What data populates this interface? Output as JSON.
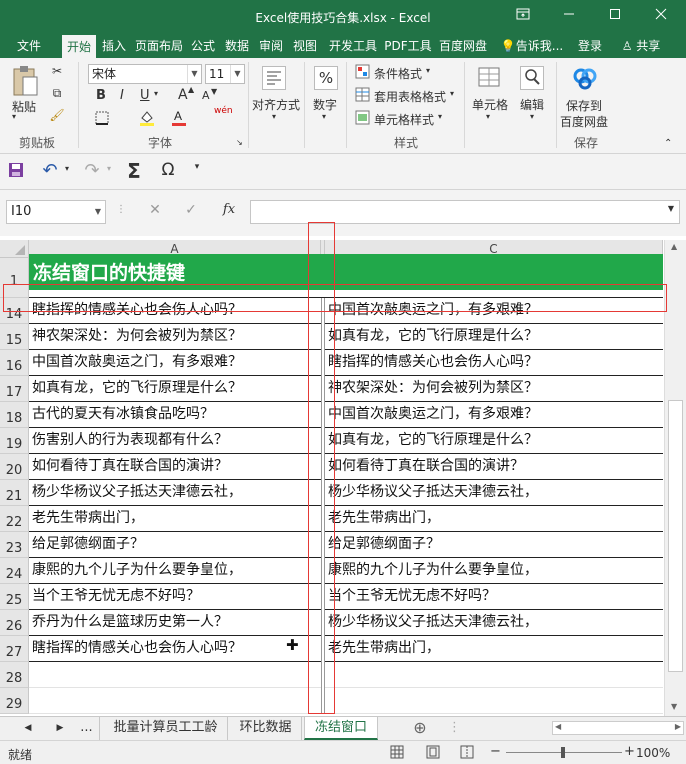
{
  "window": {
    "title": "Excel使用技巧合集.xlsx - Excel",
    "icons": [
      "ribbon-display-icon",
      "minimize-icon",
      "maximize-icon",
      "close-icon"
    ]
  },
  "ribbon_tabs": [
    "文件",
    "开始",
    "插入",
    "页面布局",
    "公式",
    "数据",
    "审阅",
    "视图",
    "开发工具",
    "PDF工具",
    "百度网盘"
  ],
  "tell_me": "告诉我...",
  "signin": "登录",
  "share": "共享",
  "ribbon": {
    "clipboard": {
      "paste": "粘贴",
      "label": "剪贴板"
    },
    "font": {
      "name": "宋体",
      "size": "11",
      "bold": "B",
      "italic": "I",
      "underline": "U",
      "label": "字体",
      "grow": "A",
      "shrink": "A",
      "wen": "wén"
    },
    "alignment": {
      "label": "对齐方式"
    },
    "number": {
      "label": "数字",
      "symbol": "%"
    },
    "styles": {
      "conditional": "条件格式",
      "table": "套用表格格式",
      "cell": "单元格样式",
      "label": "样式"
    },
    "cells": {
      "label": "单元格"
    },
    "editing": {
      "label": "编辑"
    },
    "save": {
      "line1": "保存到",
      "line2": "百度网盘",
      "label": "保存"
    }
  },
  "qat": {
    "sigma": "Σ",
    "omega": "Ω"
  },
  "formula_bar": {
    "namebox": "I10",
    "fx": "fx",
    "value": ""
  },
  "grid": {
    "col_headers": [
      "A",
      "C"
    ],
    "banner": "冻结窗口的快捷键",
    "rows": [
      {
        "num": "1",
        "a": "",
        "c": ""
      },
      {
        "num": "14",
        "a": "瞎指挥的情感关心也会伤人心吗？",
        "c": "中国首次敲奥运之门，有多艰难？"
      },
      {
        "num": "15",
        "a": "神农架深处：为何会被列为禁区？",
        "c": "如真有龙，它的飞行原理是什么？"
      },
      {
        "num": "16",
        "a": "中国首次敲奥运之门，有多艰难？",
        "c": "瞎指挥的情感关心也会伤人心吗？"
      },
      {
        "num": "17",
        "a": "如真有龙，它的飞行原理是什么？",
        "c": "神农架深处：为何会被列为禁区？"
      },
      {
        "num": "18",
        "a": "古代的夏天有冰镇食品吃吗？",
        "c": "中国首次敲奥运之门，有多艰难？"
      },
      {
        "num": "19",
        "a": "伤害别人的行为表现都有什么？",
        "c": "如真有龙，它的飞行原理是什么？"
      },
      {
        "num": "20",
        "a": "如何看待丁真在联合国的演讲？",
        "c": "如何看待丁真在联合国的演讲？"
      },
      {
        "num": "21",
        "a": "杨少华杨议父子抵达天津德云社，",
        "c": "杨少华杨议父子抵达天津德云社，"
      },
      {
        "num": "22",
        "a": "老先生带病出门，",
        "c": "老先生带病出门，"
      },
      {
        "num": "23",
        "a": "给足郭德纲面子？",
        "c": "给足郭德纲面子？"
      },
      {
        "num": "24",
        "a": "康熙的九个儿子为什么要争皇位，",
        "c": "康熙的九个儿子为什么要争皇位，"
      },
      {
        "num": "25",
        "a": "当个王爷无忧无虑不好吗？",
        "c": "当个王爷无忧无虑不好吗？"
      },
      {
        "num": "26",
        "a": "乔丹为什么是篮球历史第一人？",
        "c": "杨少华杨议父子抵达天津德云社，"
      },
      {
        "num": "27",
        "a": "瞎指挥的情感关心也会伤人心吗？",
        "c": "老先生带病出门，"
      },
      {
        "num": "28",
        "a": "",
        "c": ""
      },
      {
        "num": "29",
        "a": "",
        "c": ""
      }
    ],
    "highlight_color": "#e53935",
    "banner_color": "#21a84a"
  },
  "sheet_tabs": {
    "ellipsis": "...",
    "tabs": [
      "批量计算员工工龄",
      "环比数据",
      "冻结窗口"
    ],
    "active": "冻结窗口",
    "add": "⊕"
  },
  "status": {
    "ready": "就绪",
    "zoom": "100%"
  }
}
